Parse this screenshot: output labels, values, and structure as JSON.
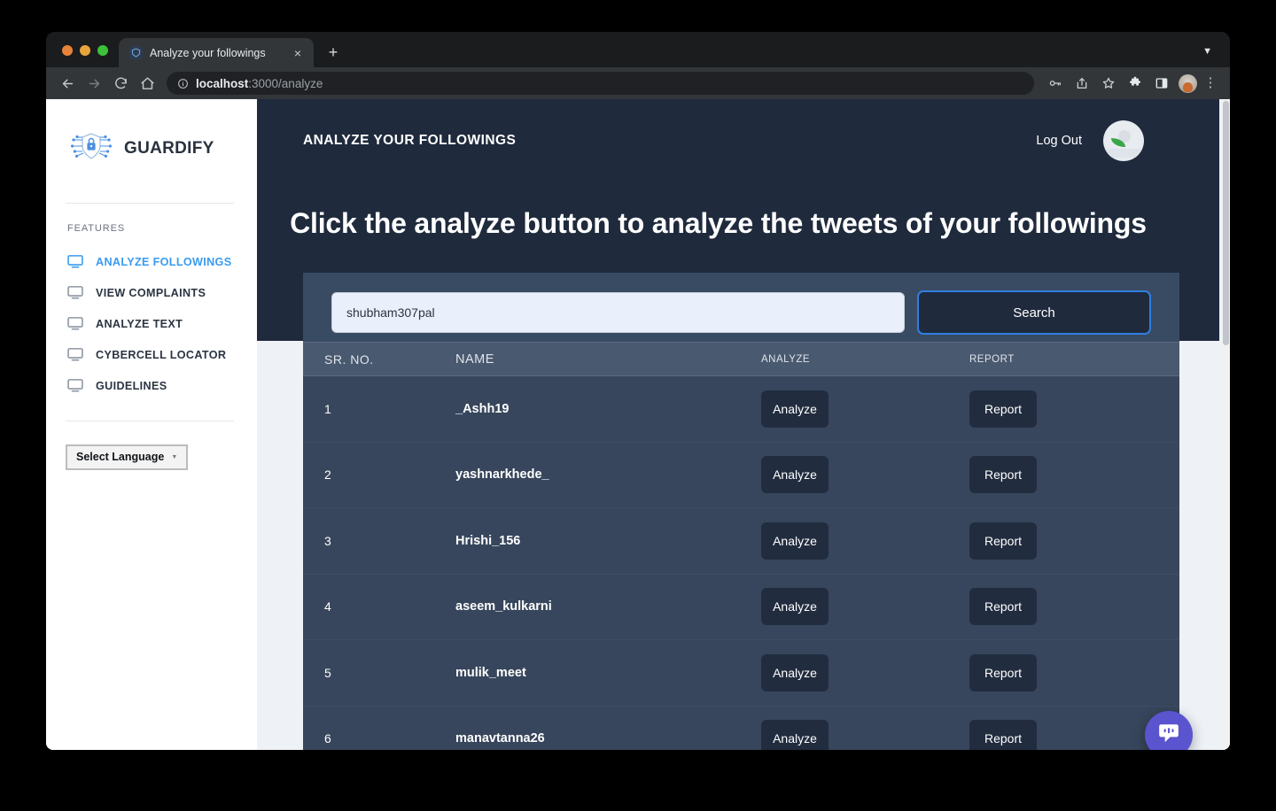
{
  "browser": {
    "tab": {
      "title": "Analyze your followings",
      "favicon_icon": "shield-favicon",
      "close_icon": "×"
    },
    "new_tab_label": "+",
    "tabstrip_chevron_icon": "▼",
    "nav": {
      "back_icon": "←",
      "forward_icon": "→",
      "reload_icon": "⟳",
      "home_icon": "⌂"
    },
    "omnibox": {
      "info_icon": "ⓘ",
      "url_host": "localhost",
      "url_path": ":3000/analyze"
    },
    "toolbar_right": {
      "password_icon": "key-icon",
      "share_icon": "share-icon",
      "bookmark_icon": "star-icon",
      "extensions_icon": "puzzle-icon",
      "sidepanel_icon": "side-panel-icon",
      "profile_icon": "profile-avatar",
      "menu_icon": "⋮"
    }
  },
  "sidebar": {
    "brand": {
      "name": "GUARDIFY",
      "logo_icon": "guardify-shield-lock-icon"
    },
    "features_label": "FEATURES",
    "items": [
      {
        "label": "ANALYZE FOLLOWINGS",
        "icon": "monitor-icon",
        "active": true
      },
      {
        "label": "VIEW COMPLAINTS",
        "icon": "monitor-icon",
        "active": false
      },
      {
        "label": "ANALYZE TEXT",
        "icon": "monitor-icon",
        "active": false
      },
      {
        "label": "CYBERCELL LOCATOR",
        "icon": "monitor-icon",
        "active": false
      },
      {
        "label": "GUIDELINES",
        "icon": "monitor-icon",
        "active": false
      }
    ],
    "language_select": {
      "label": "Select Language",
      "caret_icon": "▼"
    }
  },
  "header": {
    "title": "ANALYZE YOUR FOLLOWINGS",
    "logout_label": "Log Out",
    "avatar_icon": "user-avatar"
  },
  "hero": {
    "headline": "Click the analyze button to analyze the tweets of your followings"
  },
  "search": {
    "value": "shubham307pal",
    "placeholder": "shubham307pal",
    "button_label": "Search"
  },
  "table": {
    "columns": [
      "SR. NO.",
      "NAME",
      "ANALYZE",
      "REPORT"
    ],
    "rows": [
      {
        "sr": "1",
        "name": "_Ashh19",
        "analyze": "Analyze",
        "report": "Report"
      },
      {
        "sr": "2",
        "name": "yashnarkhede_",
        "analyze": "Analyze",
        "report": "Report"
      },
      {
        "sr": "3",
        "name": "Hrishi_156",
        "analyze": "Analyze",
        "report": "Report"
      },
      {
        "sr": "4",
        "name": "aseem_kulkarni",
        "analyze": "Analyze",
        "report": "Report"
      },
      {
        "sr": "5",
        "name": "mulik_meet",
        "analyze": "Analyze",
        "report": "Report"
      },
      {
        "sr": "6",
        "name": "manavtanna26",
        "analyze": "Analyze",
        "report": "Report"
      }
    ]
  },
  "chat_widget": {
    "icon": "chat-bubble-icon"
  },
  "colors": {
    "navy": "#1f2a3d",
    "table_row": "#37465c",
    "table_head": "#49596f",
    "search_band": "#394a63",
    "accent_blue": "#3a9bf0",
    "search_border": "#2f7fe0",
    "chat_purple": "#5a54cf",
    "page_bg": "#eef2f7"
  }
}
